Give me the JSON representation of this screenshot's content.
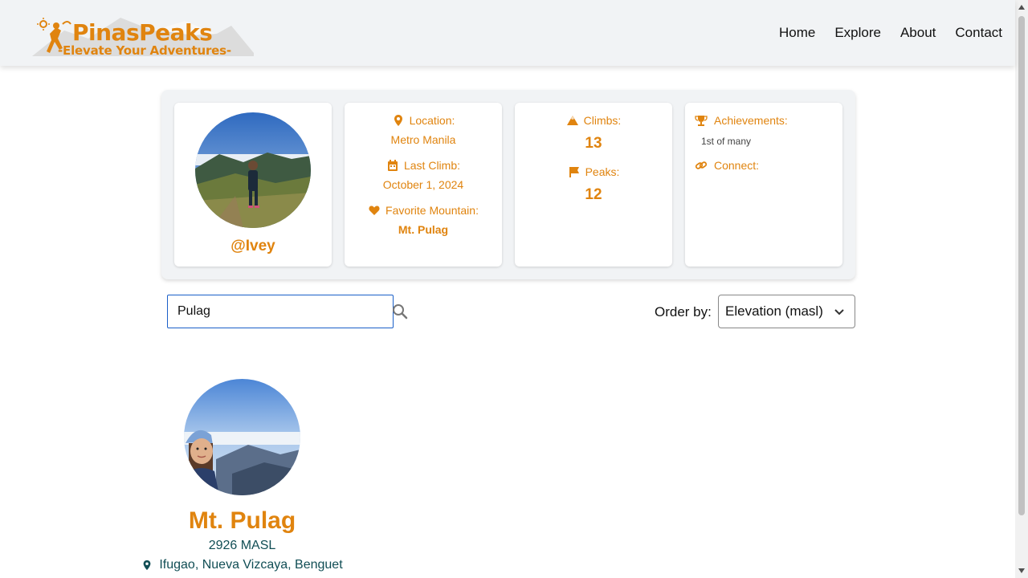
{
  "brand": {
    "title": "PinasPeaks",
    "tagline": "-Elevate Your Adventures-"
  },
  "nav": {
    "items": [
      {
        "label": "Home"
      },
      {
        "label": "Explore"
      },
      {
        "label": "About"
      },
      {
        "label": "Contact"
      }
    ]
  },
  "profile": {
    "username": "@Ivey",
    "location_label": "Location:",
    "location_value": "Metro Manila",
    "last_climb_label": "Last Climb:",
    "last_climb_value": "October 1, 2024",
    "favorite_label": "Favorite Mountain:",
    "favorite_value": "Mt. Pulag",
    "climbs_label": "Climbs:",
    "climbs_value": "13",
    "peaks_label": "Peaks:",
    "peaks_value": "12",
    "achievements_label": "Achievements:",
    "achievements_value": "1st of many",
    "connect_label": "Connect:"
  },
  "search": {
    "value": "Pulag"
  },
  "order": {
    "label": "Order by:",
    "selected": "Elevation (masl)"
  },
  "results": [
    {
      "name": "Mt. Pulag",
      "elevation": "2926 MASL",
      "location": "Ifugao, Nueva Vizcaya, Benguet"
    }
  ],
  "colors": {
    "accent": "#e0840f",
    "teal": "#114e55",
    "focus": "#1a5fc8"
  }
}
